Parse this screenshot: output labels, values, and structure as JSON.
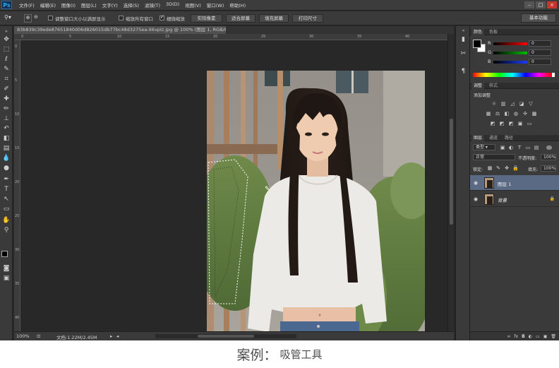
{
  "menubar": {
    "logo": "Ps",
    "items": [
      "文件(F)",
      "编辑(E)",
      "图像(I)",
      "图层(L)",
      "文字(Y)",
      "选择(S)",
      "滤镜(T)",
      "3D(D)",
      "视图(V)",
      "窗口(W)",
      "帮助(H)"
    ],
    "window_buttons": [
      "–",
      "□",
      "×"
    ]
  },
  "options": {
    "tool_label": "🔍",
    "resize_windows_label": "调整窗口大小以满屏显示",
    "zoom_all_label": "缩放所有窗口",
    "scrubby_zoom_label": "细微缩放",
    "scrubby_zoom_checked": true,
    "actual_pixels": "实际像素",
    "fit_screen": "适合屏幕",
    "fill_screen": "填充屏幕",
    "print_size": "打印尺寸",
    "workspace": "基本功能"
  },
  "document": {
    "tab_title": "83b839c39ede87651840d06d826015db77bc48d3275ea-X6vpIz.jpg @ 100% (图层 1, RGB/8#) *",
    "tab_close": "×",
    "ruler_ticks": [
      "0",
      "5",
      "10",
      "15",
      "20",
      "25",
      "30",
      "35",
      "40"
    ]
  },
  "status": {
    "zoom": "100%",
    "doc_info": "文档:1.22M/2.45M"
  },
  "panels": {
    "color_tabs": [
      "颜色",
      "色板"
    ],
    "channels": [
      {
        "label": "R",
        "value": "0"
      },
      {
        "label": "G",
        "value": "0"
      },
      {
        "label": "B",
        "value": "0"
      }
    ],
    "adjust_tabs": [
      "调整",
      "样式"
    ],
    "adjust_title": "添加调整",
    "layers_tabs": [
      "图层",
      "通道",
      "路径"
    ],
    "kind_label": "类型",
    "blend_mode": "正常",
    "opacity_label": "不透明度:",
    "opacity_value": "100%",
    "lock_label": "锁定:",
    "fill_label": "填充:",
    "fill_value": "100%",
    "layers": [
      {
        "name": "图层 1",
        "selected": true
      },
      {
        "name": "背景",
        "selected": false,
        "locked": true
      }
    ],
    "bottom_icons": [
      "∞",
      "fx",
      "◘",
      "◐",
      "▭",
      "▣",
      "🗑"
    ]
  },
  "caption": {
    "title": "案例：",
    "subtitle": "吸管工具"
  },
  "colors": {
    "app_bg": "#282828",
    "panel_bg": "#3a3a3a",
    "selected_layer": "#5a6a85"
  }
}
